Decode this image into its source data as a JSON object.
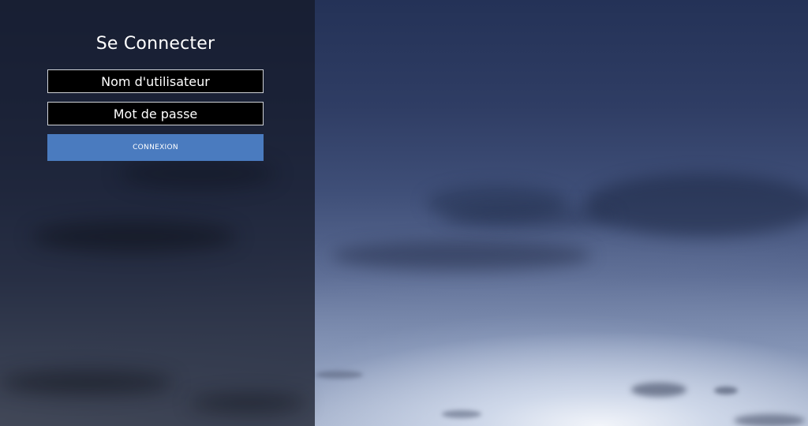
{
  "login": {
    "title": "Se Connecter",
    "username_placeholder": "Nom d'utilisateur",
    "password_placeholder": "Mot de passe",
    "submit_label": "CONNEXION"
  },
  "colors": {
    "panel_overlay": "#141826",
    "button": "#4a7bbf",
    "field_background": "#000000",
    "field_border": "#d0d3d8",
    "text": "#ffffff",
    "sky_top": "#243257",
    "sky_horizon": "#b9c4d9"
  }
}
